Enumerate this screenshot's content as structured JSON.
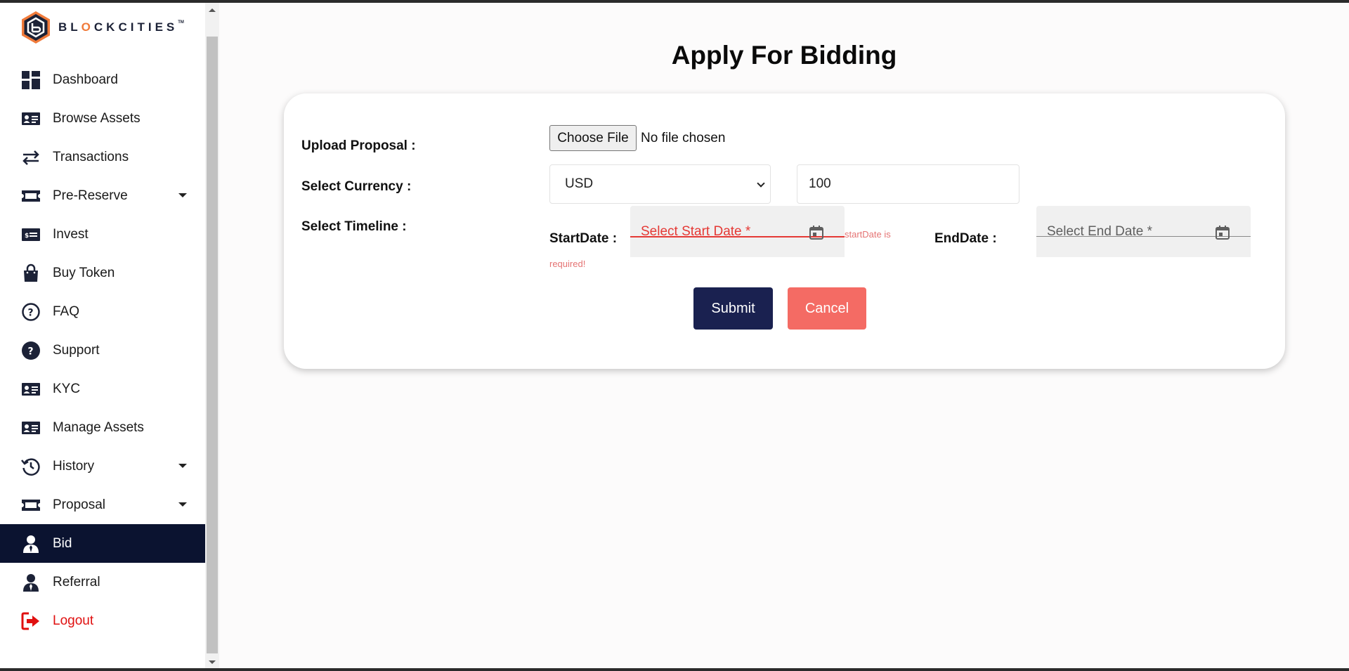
{
  "app": {
    "logo_text_before": "BL",
    "logo_text_o": "O",
    "logo_text_after": "CKCITIES",
    "logo_tm": "TM"
  },
  "sidebar": {
    "items": [
      {
        "label": "Dashboard",
        "icon": "dashboard-icon"
      },
      {
        "label": "Browse Assets",
        "icon": "id-card-icon"
      },
      {
        "label": "Transactions",
        "icon": "swap-arrows-icon"
      },
      {
        "label": "Pre-Reserve",
        "icon": "ticket-icon",
        "dropdown": true
      },
      {
        "label": "Invest",
        "icon": "money-icon"
      },
      {
        "label": "Buy Token",
        "icon": "shopping-bag-icon"
      },
      {
        "label": "FAQ",
        "icon": "question-circle-outline-icon"
      },
      {
        "label": "Support",
        "icon": "question-circle-icon"
      },
      {
        "label": "KYC",
        "icon": "id-card-icon"
      },
      {
        "label": "Manage Assets",
        "icon": "id-card-icon"
      },
      {
        "label": "History",
        "icon": "history-icon",
        "dropdown": true
      },
      {
        "label": "Proposal",
        "icon": "ticket-icon",
        "dropdown": true
      },
      {
        "label": "Bid",
        "icon": "user-tie-icon",
        "active": true
      },
      {
        "label": "Referral",
        "icon": "user-tie-icon"
      },
      {
        "label": "Logout",
        "icon": "logout-icon"
      }
    ]
  },
  "main": {
    "title": "Apply For Bidding",
    "form": {
      "upload_label": "Upload Proposal :",
      "choose_file_label": "Choose File",
      "no_file_text": "No file chosen",
      "currency_label": "Select Currency :",
      "currency_value": "USD",
      "amount_value": "100",
      "timeline_label": "Select Timeline :",
      "start_date_label": "StartDate :",
      "start_date_placeholder": "Select Start Date *",
      "start_date_error_1": "startDate is",
      "start_date_error_2": "required!",
      "end_date_label": "EndDate :",
      "end_date_placeholder": "Select End Date *",
      "submit_label": "Submit",
      "cancel_label": "Cancel"
    }
  },
  "colors": {
    "active_nav_bg": "#0b1330",
    "submit_bg": "#1a2150",
    "cancel_bg": "#f46b64",
    "error": "#e53935",
    "logout": "#e01010",
    "logo_accent": "#f07a3a"
  }
}
